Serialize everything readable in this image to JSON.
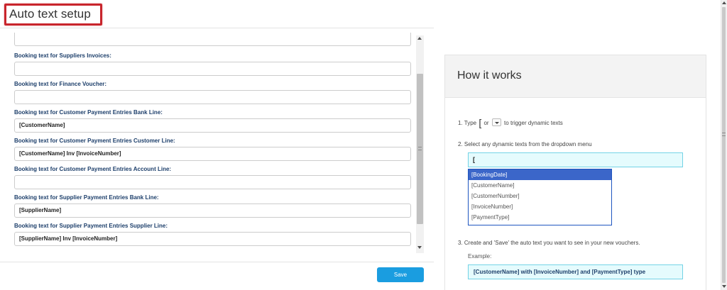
{
  "page": {
    "title": "Auto text setup"
  },
  "form": {
    "fields": [
      {
        "label": "Booking text for Suppliers Invoices:",
        "value": ""
      },
      {
        "label": "Booking text for Finance Voucher:",
        "value": ""
      },
      {
        "label": "Booking text for Customer Payment Entries Bank Line:",
        "value": "[CustomerName]"
      },
      {
        "label": "Booking text for Customer Payment Entries Customer Line:",
        "value": "[CustomerName] Inv [InvoiceNumber]"
      },
      {
        "label": "Booking text for Customer Payment Entries Account Line:",
        "value": ""
      },
      {
        "label": "Booking text for Supplier Payment Entries Bank Line:",
        "value": "[SupplierName]"
      },
      {
        "label": "Booking text for Supplier Payment Entries Supplier Line:",
        "value": "[SupplierName] Inv [InvoiceNumber]"
      }
    ],
    "save_label": "Save"
  },
  "how": {
    "title": "How it works",
    "step1_prefix": "1. Type",
    "step1_bracket": "[",
    "step1_or": "or",
    "step1_suffix": "to trigger dynamic texts",
    "step2": "2. Select any dynamic texts from the dropdown menu",
    "demo_input_value": "[",
    "dropdown_items": [
      "[BookingDate]",
      "[CustomerName]",
      "[CustomerNumber]",
      "[InvoiceNumber]",
      "[PaymentType]"
    ],
    "step3": "3. Create and 'Save' the auto text you want to see in your new vouchers.",
    "example_label": "Example:",
    "example_text": "[CustomerName] with [InvoiceNumber] and [PaymentType] type"
  },
  "colors": {
    "accent": "#1a9de0",
    "title_highlight": "#c8252c",
    "label_text": "#1d3f6b",
    "selected_item": "#3b66c9"
  }
}
